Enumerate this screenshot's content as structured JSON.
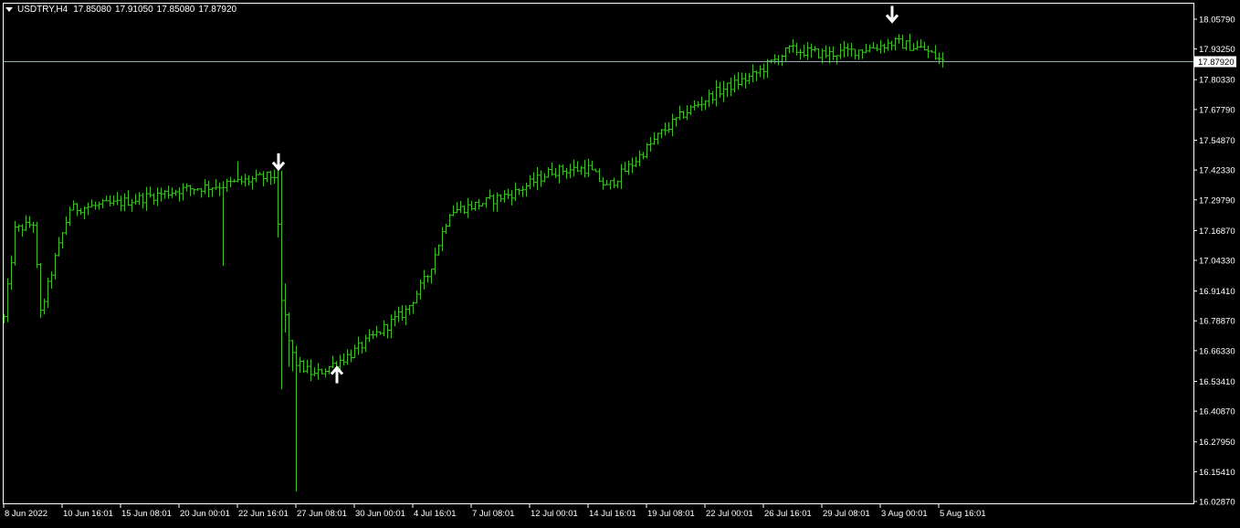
{
  "header": {
    "symbol_label": "USDTRY,H4",
    "open": "17.85080",
    "high": "17.91050",
    "low": "17.85080",
    "close": "17.87920"
  },
  "colors": {
    "background": "#000000",
    "frame": "#ffffff",
    "bars": "#3fbf26",
    "bid_line": "#8fa7ad",
    "text": "#ffffff",
    "arrows": "#ffffff"
  },
  "chart_data": {
    "type": "ohlc",
    "instrument": "USDTRY",
    "timeframe": "H4",
    "current_price": 17.8792,
    "current_price_label": "17.87920",
    "ylim": [
      16.0281,
      18.0888
    ],
    "yticks": [
      "18.05790",
      "17.93250",
      "17.80330",
      "17.67790",
      "17.54870",
      "17.42330",
      "17.29790",
      "17.16870",
      "17.04330",
      "16.91410",
      "16.78870",
      "16.66330",
      "16.53410",
      "16.40870",
      "16.27950",
      "16.15410",
      "16.02870"
    ],
    "xticks": [
      "8 Jun 2022",
      "10 Jun 16:01",
      "15 Jun 08:01",
      "20 Jun 00:01",
      "22 Jun 16:01",
      "27 Jun 08:01",
      "30 Jun 00:01",
      "4 Jul 16:01",
      "7 Jul 08:01",
      "12 Jul 00:01",
      "14 Jul 16:01",
      "19 Jul 08:01",
      "22 Jul 00:01",
      "26 Jul 16:01",
      "29 Jul 08:01",
      "3 Aug 00:01",
      "5 Aug 16:01"
    ],
    "xtick_bar_index": [
      0,
      16,
      32,
      48,
      64,
      80,
      96,
      112,
      128,
      144,
      160,
      176,
      192,
      208,
      224,
      240,
      256
    ],
    "total_bars": 258,
    "signals": [
      {
        "type": "sell",
        "bar_index": 75,
        "price": 17.44
      },
      {
        "type": "buy",
        "bar_index": 91,
        "price": 16.58
      },
      {
        "type": "sell",
        "bar_index": 243,
        "price": 18.06
      }
    ],
    "bars_anchor_closes": [
      {
        "bar_index": 0,
        "close": 16.8
      },
      {
        "bar_index": 3,
        "close": 17.17
      },
      {
        "bar_index": 8,
        "close": 17.2
      },
      {
        "bar_index": 10,
        "close": 16.82
      },
      {
        "bar_index": 14,
        "close": 17.05
      },
      {
        "bar_index": 18,
        "close": 17.26
      },
      {
        "bar_index": 30,
        "close": 17.28
      },
      {
        "bar_index": 48,
        "close": 17.34
      },
      {
        "bar_index": 60,
        "close": 17.36
      },
      {
        "bar_index": 74,
        "close": 17.4
      },
      {
        "bar_index": 76,
        "close": 16.85
      },
      {
        "bar_index": 79,
        "close": 16.62
      },
      {
        "bar_index": 85,
        "close": 16.56
      },
      {
        "bar_index": 95,
        "close": 16.65
      },
      {
        "bar_index": 110,
        "close": 16.83
      },
      {
        "bar_index": 116,
        "close": 16.98
      },
      {
        "bar_index": 122,
        "close": 17.25
      },
      {
        "bar_index": 130,
        "close": 17.28
      },
      {
        "bar_index": 140,
        "close": 17.33
      },
      {
        "bar_index": 150,
        "close": 17.42
      },
      {
        "bar_index": 160,
        "close": 17.43
      },
      {
        "bar_index": 165,
        "close": 17.35
      },
      {
        "bar_index": 172,
        "close": 17.45
      },
      {
        "bar_index": 180,
        "close": 17.58
      },
      {
        "bar_index": 186,
        "close": 17.66
      },
      {
        "bar_index": 195,
        "close": 17.75
      },
      {
        "bar_index": 205,
        "close": 17.82
      },
      {
        "bar_index": 215,
        "close": 17.93
      },
      {
        "bar_index": 225,
        "close": 17.91
      },
      {
        "bar_index": 235,
        "close": 17.93
      },
      {
        "bar_index": 244,
        "close": 17.96
      },
      {
        "bar_index": 252,
        "close": 17.93
      },
      {
        "bar_index": 257,
        "close": 17.8792
      }
    ],
    "grid": false,
    "legend": "none"
  }
}
